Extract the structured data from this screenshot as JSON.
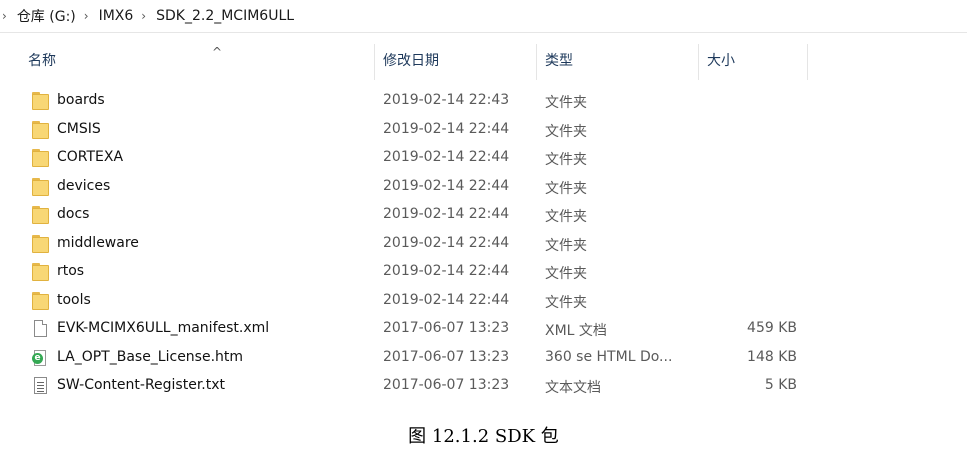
{
  "breadcrumb": [
    "仓库 (G:)",
    "IMX6",
    "SDK_2.2_MCIM6ULL"
  ],
  "columns": {
    "name": "名称",
    "date": "修改日期",
    "type": "类型",
    "size": "大小"
  },
  "files": [
    {
      "name": "boards",
      "date": "2019-02-14 22:43",
      "type": "文件夹",
      "size": "",
      "icon": "folder-icon"
    },
    {
      "name": "CMSIS",
      "date": "2019-02-14 22:44",
      "type": "文件夹",
      "size": "",
      "icon": "folder-icon"
    },
    {
      "name": "CORTEXA",
      "date": "2019-02-14 22:44",
      "type": "文件夹",
      "size": "",
      "icon": "folder-icon"
    },
    {
      "name": "devices",
      "date": "2019-02-14 22:44",
      "type": "文件夹",
      "size": "",
      "icon": "folder-icon"
    },
    {
      "name": "docs",
      "date": "2019-02-14 22:44",
      "type": "文件夹",
      "size": "",
      "icon": "folder-icon"
    },
    {
      "name": "middleware",
      "date": "2019-02-14 22:44",
      "type": "文件夹",
      "size": "",
      "icon": "folder-icon"
    },
    {
      "name": "rtos",
      "date": "2019-02-14 22:44",
      "type": "文件夹",
      "size": "",
      "icon": "folder-icon"
    },
    {
      "name": "tools",
      "date": "2019-02-14 22:44",
      "type": "文件夹",
      "size": "",
      "icon": "folder-icon"
    },
    {
      "name": "EVK-MCIMX6ULL_manifest.xml",
      "date": "2017-06-07 13:23",
      "type": "XML 文档",
      "size": "459 KB",
      "icon": "xml-file-icon"
    },
    {
      "name": "LA_OPT_Base_License.htm",
      "date": "2017-06-07 13:23",
      "type": "360 se HTML Do...",
      "size": "148 KB",
      "icon": "html-file-icon"
    },
    {
      "name": "SW-Content-Register.txt",
      "date": "2017-06-07 13:23",
      "type": "文本文档",
      "size": "5 KB",
      "icon": "text-file-icon"
    }
  ],
  "caption": "图 12.1.2 SDK 包"
}
